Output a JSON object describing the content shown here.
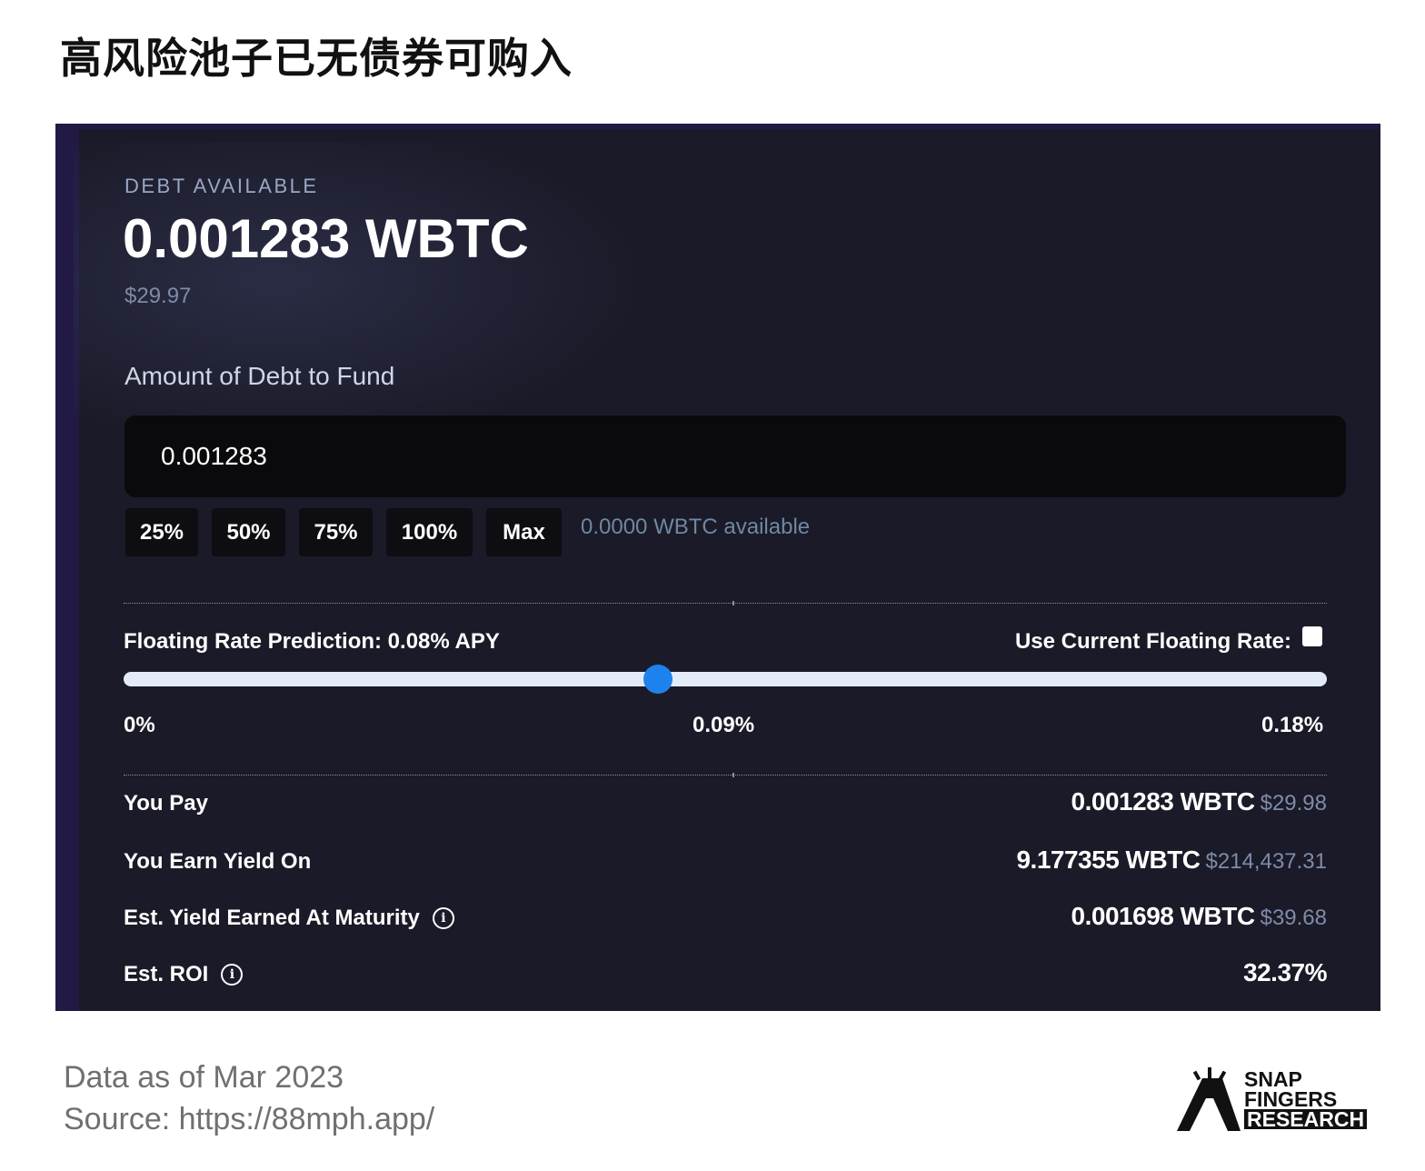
{
  "page_title": "高风险池子已无债券可购入",
  "debt": {
    "label": "DEBT AVAILABLE",
    "amount": "0.001283 WBTC",
    "usd": "$29.97"
  },
  "fund": {
    "label": "Amount of Debt to Fund",
    "input_value": "0.001283",
    "percent_buttons": [
      "25%",
      "50%",
      "75%",
      "100%",
      "Max"
    ],
    "available": "0.0000 WBTC available"
  },
  "rate": {
    "prediction_label": "Floating Rate Prediction: 0.08% APY",
    "use_current_label": "Use Current Floating Rate:",
    "use_current_checked": false,
    "slider_min": 0,
    "slider_max": 0.18,
    "slider_value": 0.08,
    "scale_labels": [
      "0%",
      "0.09%",
      "0.18%"
    ],
    "thumb_color": "#1e82ee",
    "track_color": "#e3ebf8"
  },
  "summary": {
    "you_pay": {
      "label": "You Pay",
      "value": "0.001283 WBTC",
      "usd": "$29.98"
    },
    "earn_yield_on": {
      "label": "You Earn Yield On",
      "value": "9.177355 WBTC",
      "usd": "$214,437.31"
    },
    "est_yield": {
      "label": "Est. Yield Earned At Maturity",
      "value": "0.001698 WBTC",
      "usd": "$39.68"
    },
    "est_roi": {
      "label": "Est. ROI",
      "value": "32.37%"
    }
  },
  "footer": {
    "date": "Data as of Mar 2023",
    "source": "Source: https://88mph.app/"
  },
  "logo": {
    "line1": "SNAP",
    "line2": "FINGERS",
    "line3": "RESEARCH"
  },
  "colors": {
    "panel_bg": "#1a1a28",
    "muted_text": "#7f8ba8",
    "accent_blue": "#1e82ee"
  }
}
